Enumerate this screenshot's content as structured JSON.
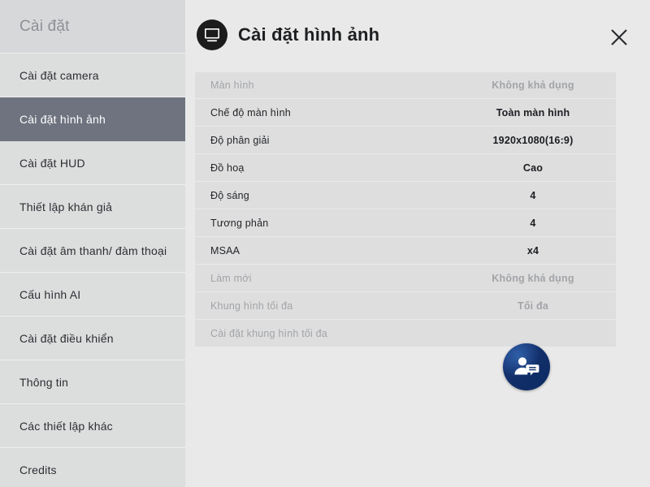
{
  "sidebar": {
    "title": "Cài đặt",
    "items": [
      {
        "label": "Cài đặt camera",
        "active": false
      },
      {
        "label": "Cài đặt hình ảnh",
        "active": true
      },
      {
        "label": "Cài đặt HUD",
        "active": false
      },
      {
        "label": "Thiết lập khán giả",
        "active": false
      },
      {
        "label": "Cài đặt âm thanh/ đàm thoại",
        "active": false
      },
      {
        "label": "Cấu hình AI",
        "active": false
      },
      {
        "label": "Cài đặt điều khiển",
        "active": false
      },
      {
        "label": "Thông tin",
        "active": false
      },
      {
        "label": "Các thiết lập khác",
        "active": false
      },
      {
        "label": "Credits",
        "active": false
      }
    ]
  },
  "header": {
    "title": "Cài đặt hình ảnh",
    "icon": "monitor-icon",
    "close_icon": "close-icon"
  },
  "settings": {
    "rows": [
      {
        "label": "Màn hình",
        "value": "Không khả dụng",
        "disabled": true
      },
      {
        "label": "Chế độ màn hình",
        "value": "Toàn màn hình",
        "disabled": false
      },
      {
        "label": "Độ phân giải",
        "value": "1920x1080(16:9)",
        "disabled": false
      },
      {
        "label": "Đồ hoạ",
        "value": "Cao",
        "disabled": false
      },
      {
        "label": "Độ sáng",
        "value": "4",
        "disabled": false
      },
      {
        "label": "Tương phản",
        "value": "4",
        "disabled": false
      },
      {
        "label": "MSAA",
        "value": "x4",
        "disabled": false
      },
      {
        "label": "Làm mới",
        "value": "Không khả dụng",
        "disabled": true
      },
      {
        "label": "Khung hình tối đa",
        "value": "Tối đa",
        "disabled": true
      },
      {
        "label": "Cài đặt khung hình tối đa",
        "value": "",
        "disabled": true
      }
    ]
  },
  "badge": {
    "icon": "person-chat-icon"
  },
  "colors": {
    "sidebar_bg": "#dadbdc",
    "sidebar_item_bg": "#dcdddd",
    "sidebar_active_bg": "#6e737f",
    "main_bg": "#e9e9e9",
    "row_bg": "#dededf",
    "row_divider": "#e9eaea",
    "text": "#232528",
    "text_disabled": "#a2a4a7",
    "badge_blue": "#13306b",
    "header_icon_bg": "#1c1c1c"
  }
}
